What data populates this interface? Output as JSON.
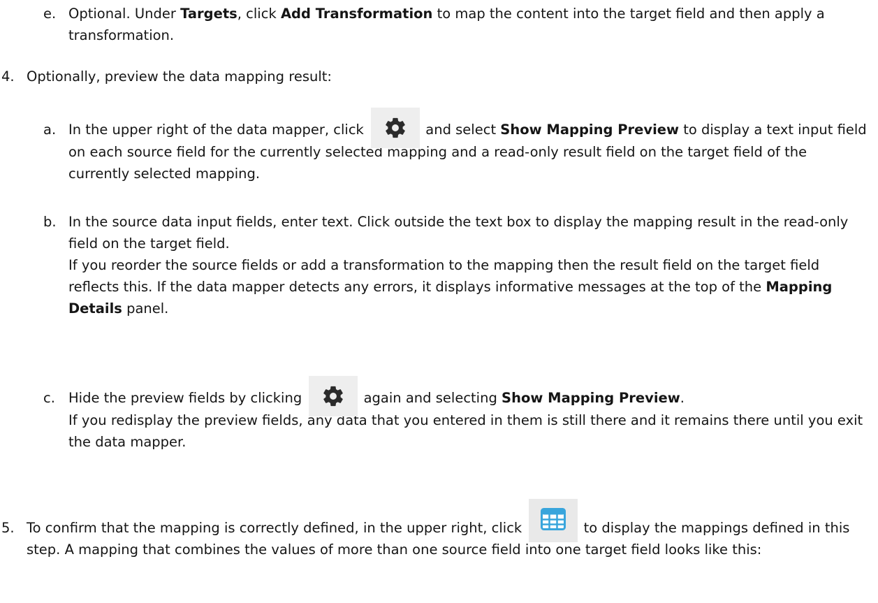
{
  "step_e": {
    "marker": "e.",
    "t1": "Optional. Under ",
    "b1": "Targets",
    "t2": ", click ",
    "b2": "Add Transformation",
    "t3": " to map the content into the target field and then apply a transformation."
  },
  "step_4": {
    "marker": "4.",
    "text": "Optionally, preview the data mapping result:",
    "a": {
      "marker": "a.",
      "t1": "In the upper right of the data mapper, click ",
      "icon": "gear-icon",
      "t2": " and select ",
      "b1": "Show Mapping Preview",
      "t3": " to display a text input field on each source field for the currently selected mapping and a read-only result field on the target field of the currently selected mapping."
    },
    "b": {
      "marker": "b.",
      "p1": "In the source data input fields, enter text. Click outside the text box to display the mapping result in the read-only field on the target field.",
      "p2_t1": "If you reorder the source fields or add a transformation to the mapping then the result field on the target field reflects this. If the data mapper detects any errors, it displays informative messages at the top of the ",
      "p2_b1": "Mapping Details",
      "p2_t2": " panel."
    },
    "c": {
      "marker": "c.",
      "t1": "Hide the preview fields by clicking ",
      "icon": "gear-icon",
      "t2": " again and selecting ",
      "b1": "Show Mapping Preview",
      "t3": ".",
      "p2": "If you redisplay the preview fields, any data that you entered in them is still there and it remains there until you exit the data mapper."
    }
  },
  "step_5": {
    "marker": "5.",
    "t1": "To confirm that the mapping is correctly defined, in the upper right, click ",
    "icon": "table-grid-icon",
    "t2": " to display the mappings defined in this step. A mapping that combines the values of more than one source field into one target field looks like this:"
  },
  "colors": {
    "text": "#151515",
    "icon_bg": "#eeeeee",
    "gear": "#2b2b2b",
    "grid": "#39a5dc"
  }
}
